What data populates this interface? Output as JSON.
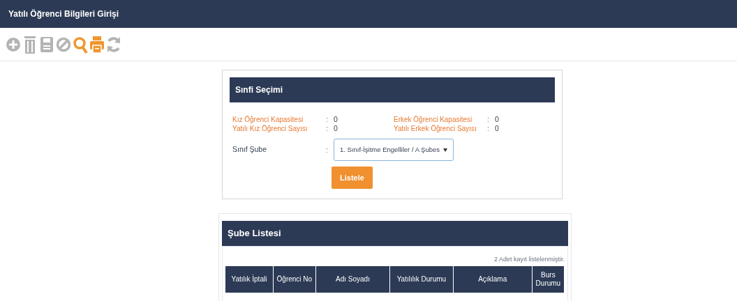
{
  "page_title": "Yatılı Öğrenci Bilgileri Girişi",
  "toolbar": [
    {
      "kind": "add",
      "enabled": false
    },
    {
      "kind": "delete",
      "enabled": false
    },
    {
      "kind": "save",
      "enabled": false
    },
    {
      "kind": "cancel",
      "enabled": false
    },
    {
      "kind": "search",
      "enabled": true
    },
    {
      "kind": "print",
      "enabled": true
    },
    {
      "kind": "refresh",
      "enabled": false
    }
  ],
  "class_panel": {
    "title": "Sınfi Seçimi",
    "stats": [
      {
        "label": "Kız Öğrenci Kapasitesi",
        "separator": ":",
        "value": "0"
      },
      {
        "label": "Erkek Öğrenci Kapasitesi",
        "separator": ":",
        "value": "0"
      },
      {
        "label": "Yatılı Kız Öğrenci Sayısı",
        "separator": ":",
        "value": "0"
      },
      {
        "label": "Yatılı Erkek Öğrenci Sayısı",
        "separator": ":",
        "value": "0"
      }
    ],
    "field_label": "Sınıf Şube",
    "field_separator": ":",
    "select_value": "1. Sınıf-İşitme Engelliler / A Şubes",
    "button": "Listele"
  },
  "list_panel": {
    "title": "Şube Listesi",
    "record_count": "2 Adet kayıt listelenmiştir.",
    "columns": [
      "Yatılık İptali",
      "Öğrenci No",
      "Adı Soyadı",
      "Yatılılık Durumu",
      "Açıklama",
      "Burs Durumu"
    ]
  }
}
